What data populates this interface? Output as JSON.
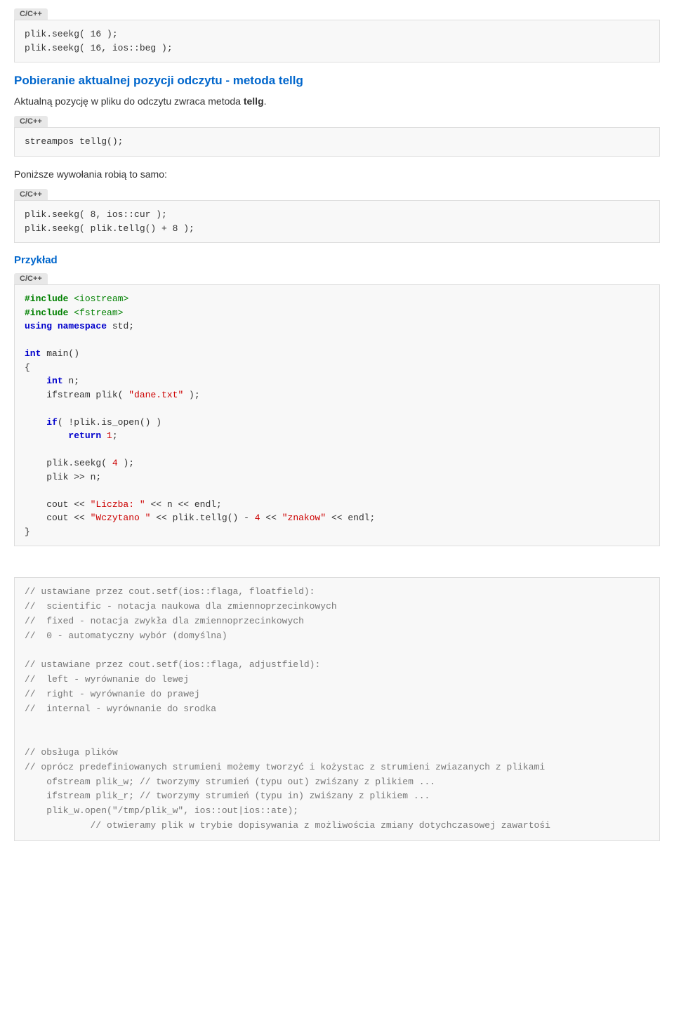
{
  "page": {
    "lang_badge": "C/C++",
    "section1": {
      "code1": "plik.seekg( 16 );\nplik.seekg( 16, ios::beg );",
      "heading": "Pobieranie aktualnej pozycji odczytu - metoda tellg",
      "intro": "Aktualną pozycję w pliku do odczytu zwraca metoda ",
      "intro_bold": "tellg",
      "intro_end": ".",
      "code2": "streampos tellg();",
      "subtext": "Poniższe wywołania robią to samo:",
      "code3": "plik.seekg( 8, ios::cur );\nplik.seekg( plik.tellg() + 8 );",
      "example_label": "Przykład",
      "code_example_heading": "C/C++",
      "comments_heading": "// ustawiane przez cout.setf(ios::flaga, floatfield):",
      "comment_lines": [
        "//  scientific - notacja naukowa dla zmiennoprzecinkowych",
        "//  fixed - notacja zwykła dla zmiennoprzecinkowych",
        "//  0 - automatyczny wybór (domyślna)",
        "",
        "// ustawiane przez cout.setf(ios::flaga, adjustfield):",
        "//  left - wyrównanie do lewej",
        "//  right - wyrównanie do prawej",
        "//  internal - wyrównanie do srodka",
        "",
        "",
        "// obsługa plików",
        "// oprócz predefiniowanych strumieni możemy tworzyć i kożystac z strumieni zwiazanych z plikami",
        "    ofstream plik_w; // tworzymy strumień (typu out) zwiśzany z plikiem ...",
        "    ifstream plik_r; // tworzymy strumień (typu in) zwiśzany z plikiem ...",
        "    plik_w.open(\"/tmp/plik_w\", ios::out|ios::ate);",
        "            // otwieramy plik w trybie dopisywania z możliwościa zmiany dotychczasowej zawartośi"
      ]
    }
  }
}
